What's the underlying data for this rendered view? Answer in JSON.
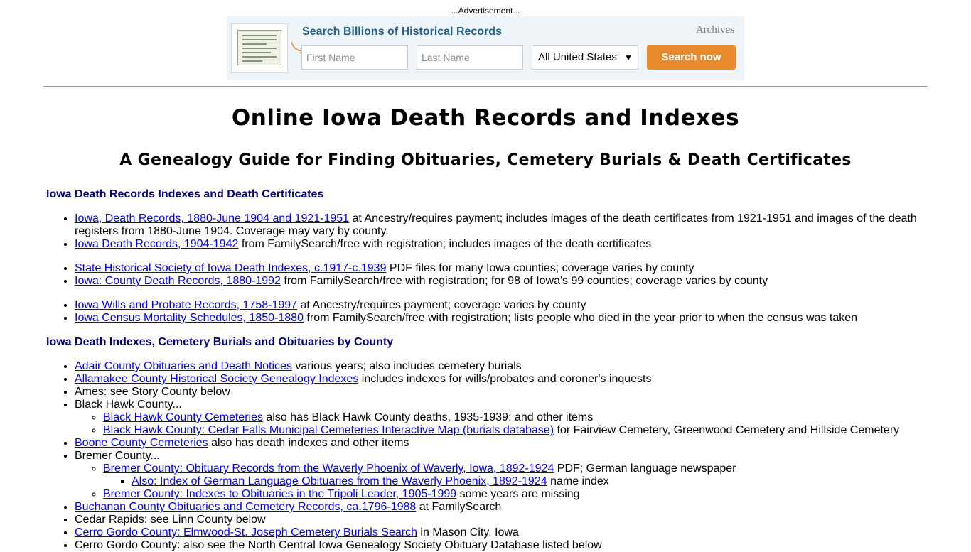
{
  "ad": {
    "label": "...Advertisement...",
    "title": "Search Billions of Historical Records",
    "brand": "Archives",
    "first_name_placeholder": "First Name",
    "last_name_placeholder": "Last Name",
    "location_selected": "All United States",
    "search_button": "Search now",
    "accent_color": "#e8892b",
    "title_color": "#1f5f8b"
  },
  "page": {
    "title": "Online Iowa Death Records and Indexes",
    "subtitle": "A Genealogy Guide for Finding Obituaries, Cemetery Burials & Death Certificates"
  },
  "section1": {
    "heading": "Iowa Death Records Indexes and Death Certificates",
    "items": [
      {
        "link": "Iowa, Death Records, 1880-June 1904 and 1921-1951",
        "text": " at Ancestry/requires payment; includes images of the death certificates from 1921-1951 and images of the death registers from 1880-June 1904. Coverage may vary by county."
      },
      {
        "link": "Iowa Death Records, 1904-1942",
        "text": " from FamilySearch/free with registration; includes images of the death certificates"
      },
      {
        "link": "State Historical Society of Iowa Death Indexes, c.1917-c.1939",
        "text": " PDF files for many Iowa counties; coverage varies by county"
      },
      {
        "link": "Iowa: County Death Records, 1880-1992",
        "text": " from FamilySearch/free with registration; for 98 of Iowa's 99 counties; coverage varies by county"
      },
      {
        "link": "Iowa Wills and Probate Records, 1758-1997",
        "text": " at Ancestry/requires payment; coverage varies by county"
      },
      {
        "link": "Iowa Census Mortality Schedules, 1850-1880",
        "text": " from FamilySearch/free with registration; lists people who died in the year prior to when the census was taken"
      }
    ]
  },
  "section2": {
    "heading": "Iowa Death Indexes, Cemetery Burials and Obituaries by County",
    "adair": {
      "link": "Adair County Obituaries and Death Notices",
      "text": " various years; also includes cemetery burials"
    },
    "allamakee": {
      "link": "Allamakee County Historical Society Genealogy Indexes",
      "text": " includes indexes for wills/probates and coroner's inquests"
    },
    "ames": "Ames: see Story County below",
    "black_hawk": {
      "label": "Black Hawk County...",
      "sub1": {
        "link": "Black Hawk County Cemeteries",
        "text": " also has Black Hawk County deaths, 1935-1939; and other items"
      },
      "sub2": {
        "link": "Black Hawk County: Cedar Falls Municipal Cemeteries Interactive Map (burials database)",
        "text": " for Fairview Cemetery, Greenwood Cemetery and Hillside Cemetery"
      }
    },
    "boone": {
      "link": "Boone County Cemeteries",
      "text": " also has death indexes and other items"
    },
    "bremer": {
      "label": "Bremer County...",
      "sub1": {
        "link": "Bremer County: Obituary Records from the Waverly Phoenix of Waverly, Iowa, 1892-1924",
        "text": " PDF; German language newspaper"
      },
      "subsub": {
        "link": "Also: Index of German Language Obituaries from the Waverly Phoenix, 1892-1924",
        "text": " name index"
      },
      "sub2": {
        "link": "Bremer County: Indexes to Obituaries in the Tripoli Leader, 1905-1999",
        "text": " some years are missing"
      }
    },
    "buchanan": {
      "link": "Buchanan County Obituaries and Cemetery Records, ca.1796-1988",
      "text": " at FamilySearch"
    },
    "cedar_rapids": "Cedar Rapids: see Linn County below",
    "cerro_gordo": {
      "link": "Cerro Gordo County: Elmwood-St. Joseph Cemetery Burials Search",
      "text": " in Mason City, Iowa"
    },
    "cerro_gordo_2": "Cerro Gordo County: also see the North Central Iowa Genealogy Society Obituary Database listed below"
  }
}
